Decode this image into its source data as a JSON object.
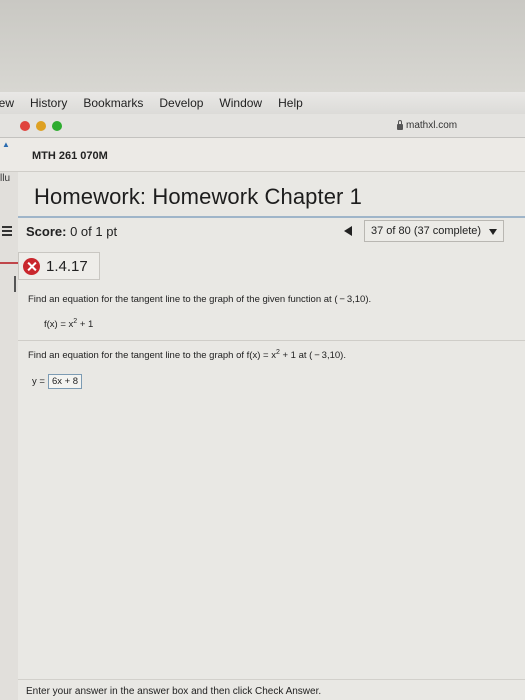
{
  "menubar": {
    "items": [
      "iew",
      "History",
      "Bookmarks",
      "Develop",
      "Window",
      "Help"
    ]
  },
  "toolbar": {
    "url": "mathxl.com",
    "lights": [
      "#e0443e",
      "#dea123",
      "#2dac2f"
    ]
  },
  "tabstrip": {
    "course": "MTH 261 070M",
    "left_fragment": "llu"
  },
  "homework": {
    "title": "Homework: Homework Chapter 1",
    "score_label": "Score:",
    "score_value": " 0 of 1 pt",
    "progress": "37 of 80 (37 complete)"
  },
  "question": {
    "number": "1.4.17",
    "status": "incorrect",
    "prompt1": "Find an equation for the tangent line to the graph of the given function at ( − 3,10).",
    "func_lhs": "f(x) = x",
    "func_exp": "2",
    "func_rhs": " + 1",
    "prompt2_a": "Find an equation for the tangent line to the graph of f(x) = x",
    "prompt2_exp": "2",
    "prompt2_b": " + 1 at ( − 3,10).",
    "answer_prefix": "y =",
    "answer_value": "6x + 8"
  },
  "footer": {
    "text": "Enter your answer in the answer box and then click Check Answer."
  },
  "colors": {
    "incorrect": "#c9272d",
    "accent_line": "#9fb5c9"
  }
}
